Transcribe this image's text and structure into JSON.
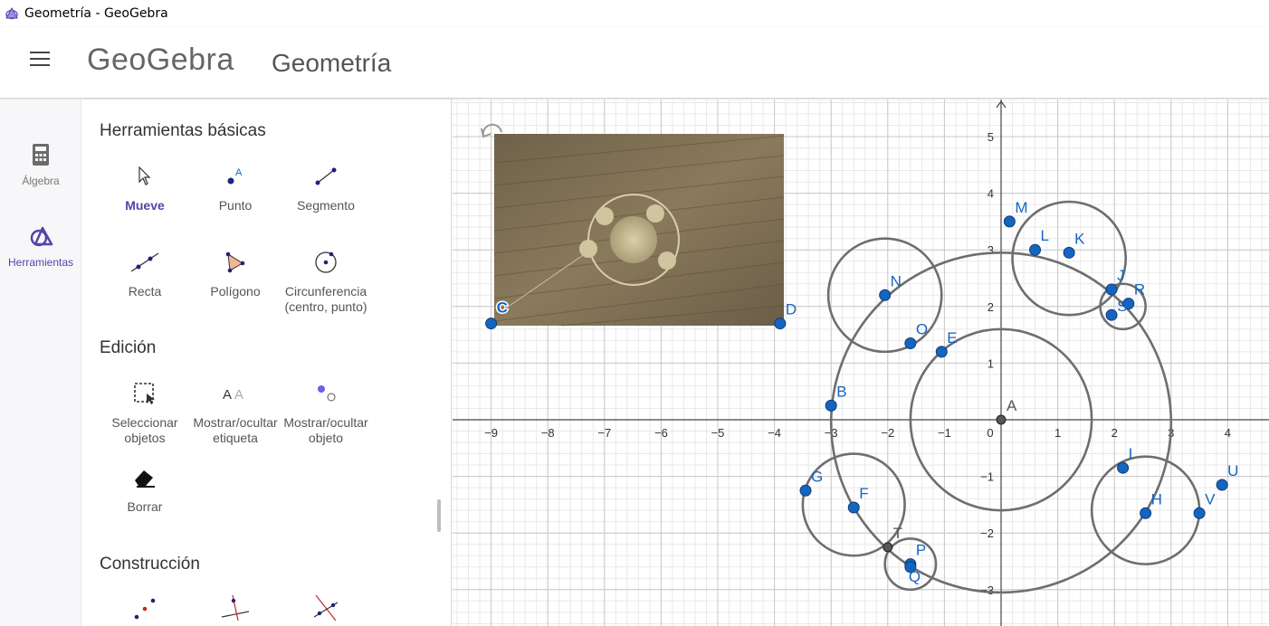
{
  "window": {
    "title": "Geometría - GeoGebra"
  },
  "header": {
    "logo": "GeoGebra",
    "app_title": "Geometría"
  },
  "rail": {
    "algebra_label": "Álgebra",
    "tools_label": "Herramientas"
  },
  "tools": {
    "sections": [
      {
        "title": "Herramientas básicas"
      },
      {
        "title": "Edición"
      },
      {
        "title": "Construcción"
      }
    ],
    "basic": [
      {
        "label": "Mueve",
        "icon": "cursor-icon"
      },
      {
        "label": "Punto",
        "icon": "point-icon"
      },
      {
        "label": "Segmento",
        "icon": "segment-icon"
      },
      {
        "label": "Recta",
        "icon": "line-icon"
      },
      {
        "label": "Polígono",
        "icon": "polygon-icon"
      },
      {
        "label": "Circunferencia (centro, punto)",
        "icon": "circle-icon"
      }
    ],
    "edit": [
      {
        "label": "Seleccionar objetos",
        "icon": "select-icon"
      },
      {
        "label": "Mostrar/ocultar etiqueta",
        "icon": "label-toggle-icon"
      },
      {
        "label": "Mostrar/ocultar objeto",
        "icon": "object-toggle-icon"
      },
      {
        "label": "Borrar",
        "icon": "eraser-icon"
      }
    ]
  },
  "graphics": {
    "x_ticks": [
      "−9",
      "−8",
      "−7",
      "−6",
      "−5",
      "−4",
      "−3",
      "−2",
      "−1",
      "0",
      "1",
      "2",
      "3",
      "4"
    ],
    "y_ticks": [
      "5",
      "4",
      "3",
      "2",
      "1",
      "−1",
      "−2",
      "−3"
    ],
    "accent": "#1565c0",
    "curve_color": "#6e6e6e",
    "points": [
      {
        "name": "A",
        "x": 0,
        "y": 0
      },
      {
        "name": "B",
        "x": -3.0,
        "y": 0.25
      },
      {
        "name": "C",
        "x": -9.0,
        "y": 1.7
      },
      {
        "name": "D",
        "x": -3.9,
        "y": 1.7
      },
      {
        "name": "E",
        "x": -1.05,
        "y": 1.2
      },
      {
        "name": "F",
        "x": -2.6,
        "y": -1.55
      },
      {
        "name": "G",
        "x": -3.45,
        "y": -1.25
      },
      {
        "name": "H",
        "x": 2.55,
        "y": -1.65
      },
      {
        "name": "I",
        "x": 2.15,
        "y": -0.85
      },
      {
        "name": "J",
        "x": 1.95,
        "y": 2.3
      },
      {
        "name": "K",
        "x": 1.2,
        "y": 2.95
      },
      {
        "name": "L",
        "x": 0.6,
        "y": 3.0
      },
      {
        "name": "M",
        "x": 0.15,
        "y": 3.5
      },
      {
        "name": "N",
        "x": -2.05,
        "y": 2.2
      },
      {
        "name": "O",
        "x": -1.6,
        "y": 1.35
      },
      {
        "name": "P",
        "x": -1.6,
        "y": -2.55
      },
      {
        "name": "Q",
        "x": -1.6,
        "y": -2.6
      },
      {
        "name": "R",
        "x": 2.25,
        "y": 2.05
      },
      {
        "name": "S",
        "x": 1.95,
        "y": 1.85
      },
      {
        "name": "T",
        "x": -2.0,
        "y": -2.25
      },
      {
        "name": "U",
        "x": 3.9,
        "y": -1.15
      },
      {
        "name": "V",
        "x": 3.5,
        "y": -1.65
      }
    ],
    "circles": [
      {
        "cx": 0.0,
        "cy": 0.0,
        "r": 1.6
      },
      {
        "cx": 0.0,
        "cy": -0.05,
        "r": 3.0
      },
      {
        "cx": -2.05,
        "cy": 2.2,
        "r": 1.0
      },
      {
        "cx": 1.2,
        "cy": 2.85,
        "r": 1.0
      },
      {
        "cx": 2.15,
        "cy": 2.0,
        "r": 0.4
      },
      {
        "cx": 2.55,
        "cy": -1.6,
        "r": 0.95
      },
      {
        "cx": -2.6,
        "cy": -1.5,
        "r": 0.9
      },
      {
        "cx": -1.6,
        "cy": -2.55,
        "r": 0.45
      }
    ]
  }
}
